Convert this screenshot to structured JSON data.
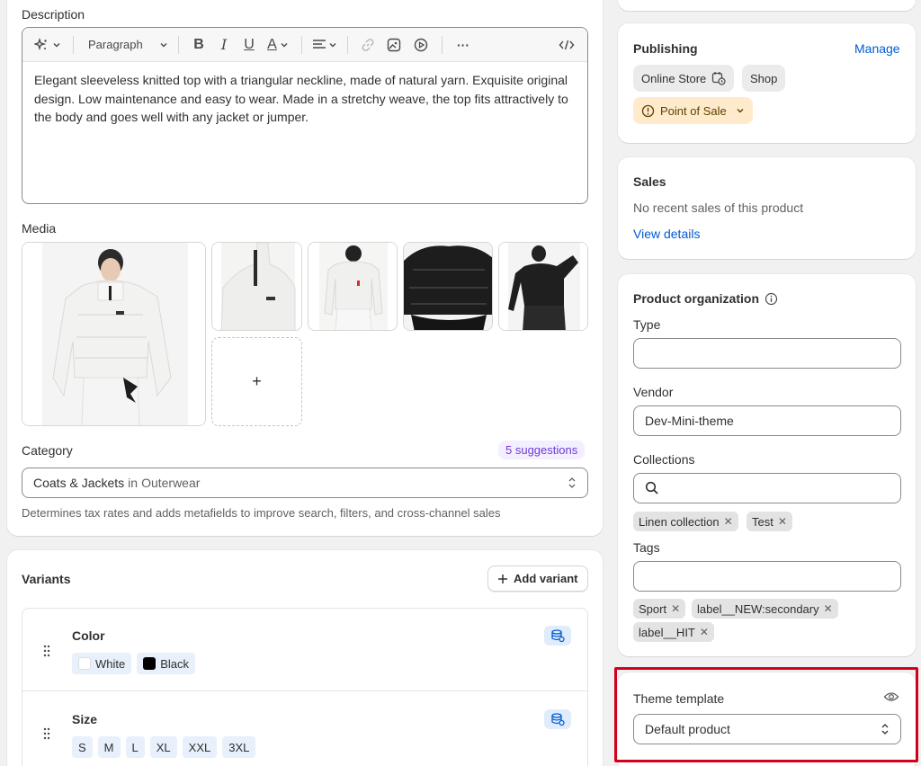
{
  "description": {
    "label": "Description",
    "toolbar": {
      "paragraph": "Paragraph",
      "bold": "B",
      "italic": "I",
      "underline": "U",
      "color": "A",
      "more": "···"
    },
    "text": "Elegant sleeveless knitted top with a triangular neckline, made of natural yarn. Exquisite original design. Low maintenance and easy to wear. Made in a stretchy weave, the top fits attractively to the body and goes well with any jacket or jumper."
  },
  "media": {
    "label": "Media",
    "add": "+"
  },
  "category": {
    "label": "Category",
    "suggestions": "5 suggestions",
    "value": "Coats & Jackets",
    "in": "in",
    "parent": "Outerwear",
    "help": "Determines tax rates and adds metafields to improve search, filters, and cross-channel sales"
  },
  "variants": {
    "title": "Variants",
    "add_label": "Add variant",
    "options": [
      {
        "name": "Color",
        "values": [
          {
            "label": "White",
            "swatch": "#ffffff"
          },
          {
            "label": "Black",
            "swatch": "#000000"
          }
        ]
      },
      {
        "name": "Size",
        "values": [
          "S",
          "M",
          "L",
          "XL",
          "XXL",
          "3XL"
        ]
      }
    ]
  },
  "publishing": {
    "title": "Publishing",
    "manage": "Manage",
    "channels": [
      "Online Store",
      "Shop"
    ],
    "pos": "Point of Sale"
  },
  "sales": {
    "title": "Sales",
    "text": "No recent sales of this product",
    "link": "View details"
  },
  "organization": {
    "title": "Product organization",
    "type_label": "Type",
    "type_value": "",
    "vendor_label": "Vendor",
    "vendor_value": "Dev-Mini-theme",
    "collections_label": "Collections",
    "collections": [
      "Linen collection",
      "Test"
    ],
    "tags_label": "Tags",
    "tags": [
      "Sport",
      "label__NEW:secondary",
      "label__HIT"
    ]
  },
  "theme": {
    "title": "Theme template",
    "value": "Default product"
  },
  "colors": {
    "accent": "#005bd3",
    "highlight": "#d0021b",
    "suggest": "#6e3ad9"
  }
}
